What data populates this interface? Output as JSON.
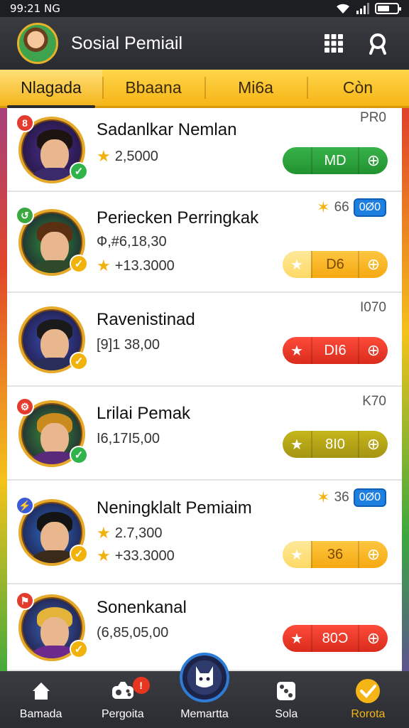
{
  "status": {
    "time": "99:21 NG"
  },
  "header": {
    "title": "Sosial Pemiail"
  },
  "tabs": [
    {
      "label": "Nlagada",
      "active": true
    },
    {
      "label": "Bbaana",
      "active": false
    },
    {
      "label": "Mi6a",
      "active": false
    },
    {
      "label": "Còn",
      "active": false
    }
  ],
  "rows": [
    {
      "name": "Sadanlkar Nemlan",
      "stat1": "2,5000",
      "stat1_icon": "star",
      "stat2": "",
      "right_top": "PR0",
      "right_chip": "",
      "pill_label": "MD",
      "pill_color": "green",
      "badge_tl": "8",
      "badge_tl_color": "#e33b2e",
      "badge_br": "✓",
      "badge_br_color": "#2fb34a",
      "hair": "#1c1410",
      "body": "#3a2a6b",
      "bg": "#4a2f8c"
    },
    {
      "name": "Periecken Perringkak",
      "stat1": "Ф,#6,18,30",
      "stat1_icon": "",
      "stat2": "+13.3000",
      "right_top": "66",
      "right_chip": "0Ø0",
      "pill_label": "D6",
      "pill_color": "yellow",
      "badge_tl": "↺",
      "badge_tl_color": "#3aa83f",
      "badge_br": "✓",
      "badge_br_color": "#f2b20c",
      "hair": "#5b2f12",
      "body": "#2f4a2a",
      "bg": "#2f8f3a"
    },
    {
      "name": "Ravenistinad",
      "stat1": "[9]1 38,00",
      "stat1_icon": "",
      "stat2": "",
      "right_top": "I070",
      "right_chip": "",
      "pill_label": "DI6",
      "pill_color": "red",
      "badge_tl": "",
      "badge_tl_color": "",
      "badge_br": "✓",
      "badge_br_color": "#f2b20c",
      "hair": "#1a1a1a",
      "body": "#2a2f5a",
      "bg": "#3a4fb5"
    },
    {
      "name": "Lrilai Pemak",
      "stat1": "I6,17I5,00",
      "stat1_icon": "",
      "stat2": "",
      "right_top": "K70",
      "right_chip": "",
      "pill_label": "8I0",
      "pill_color": "olive",
      "badge_tl": "⚙",
      "badge_tl_color": "#e33b2e",
      "badge_br": "✓",
      "badge_br_color": "#2fb34a",
      "hair": "#c98a1e",
      "body": "#5a2a7a",
      "bg": "#3a8f3a"
    },
    {
      "name": "Neningklalt Pemiaim",
      "stat1": "2.7,300",
      "stat1_icon": "star",
      "stat2": "+33.3000",
      "right_top": "36",
      "right_chip": "0Ø0",
      "pill_label": "36",
      "pill_color": "yellow",
      "badge_tl": "⚡",
      "badge_tl_color": "#3b5bd6",
      "badge_br": "✓",
      "badge_br_color": "#f2b20c",
      "hair": "#141414",
      "body": "#3a2a1a",
      "bg": "#2d6bc6"
    },
    {
      "name": "Sonenkanal",
      "stat1": "(6,85,05,00",
      "stat1_icon": "",
      "stat2": "",
      "right_top": "",
      "right_chip": "",
      "pill_label": "80Ɔ",
      "pill_color": "red",
      "badge_tl": "⚑",
      "badge_tl_color": "#e33b2e",
      "badge_br": "✓",
      "badge_br_color": "#f2b20c",
      "hair": "#e4b43a",
      "body": "#6b2a8c",
      "bg": "#3a62b5"
    }
  ],
  "nav": [
    {
      "label": "Bamada",
      "icon": "home-icon",
      "active": false
    },
    {
      "label": "Pergoita",
      "icon": "controller-icon",
      "active": false,
      "badge": "!"
    },
    {
      "label": "Memartta",
      "icon": "mascot-icon",
      "active": false,
      "center": true
    },
    {
      "label": "Sola",
      "icon": "dice-icon",
      "active": false
    },
    {
      "label": "Rorota",
      "icon": "check-icon",
      "active": true
    }
  ]
}
